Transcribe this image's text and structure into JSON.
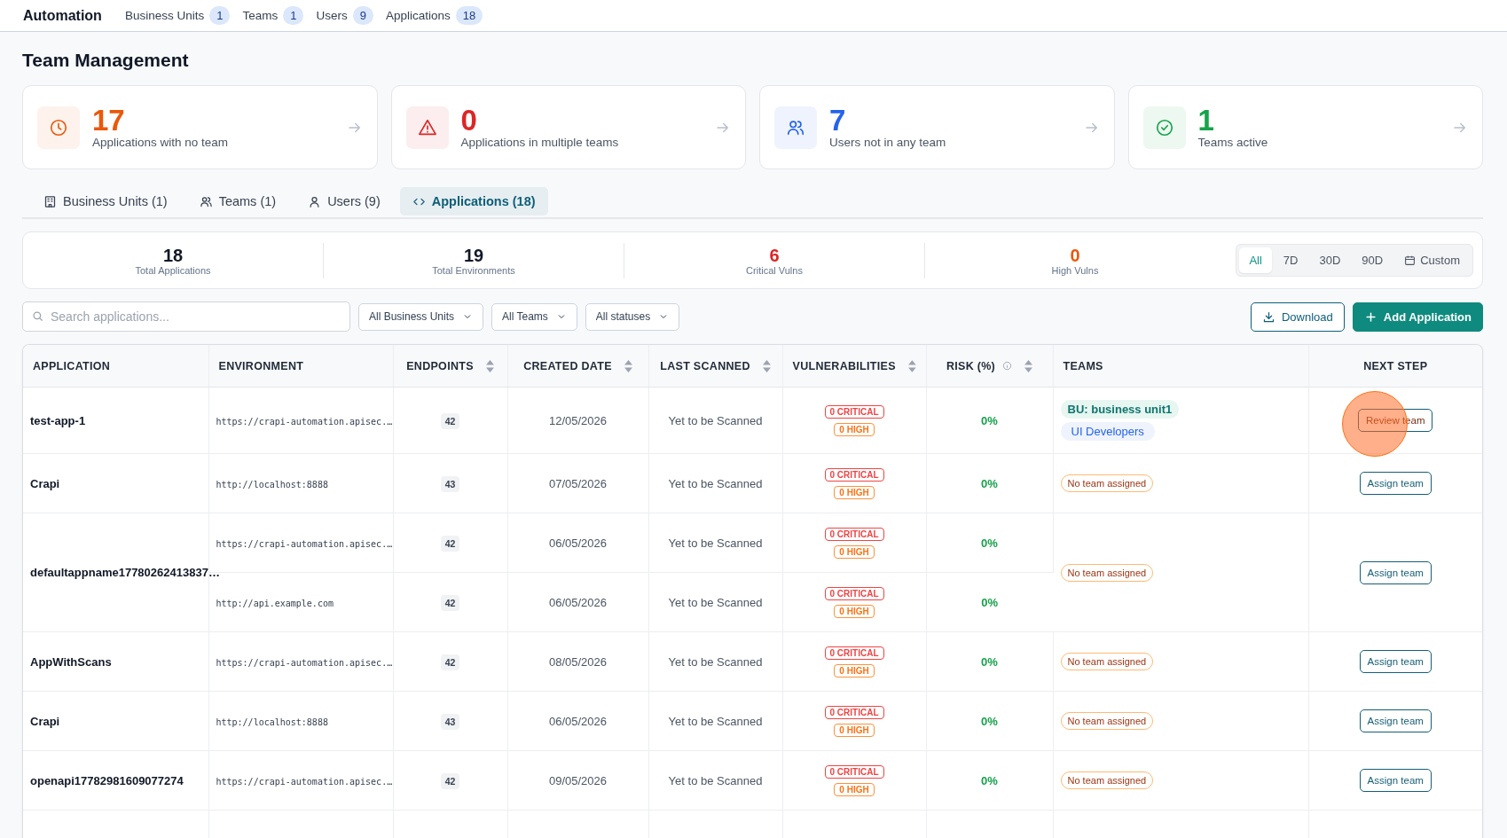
{
  "top_nav": {
    "brand": "Automation",
    "items": [
      {
        "label": "Business Units",
        "count": "1"
      },
      {
        "label": "Teams",
        "count": "1"
      },
      {
        "label": "Users",
        "count": "9"
      },
      {
        "label": "Applications",
        "count": "18"
      }
    ]
  },
  "page_title": "Team Management",
  "stat_cards": [
    {
      "kind": "clock",
      "value": "17",
      "label": "Applications with no team",
      "color": "#ea580c"
    },
    {
      "kind": "warning",
      "value": "0",
      "label": "Applications in multiple teams",
      "color": "#dc2626"
    },
    {
      "kind": "users",
      "value": "7",
      "label": "Users not in any team",
      "color": "#2563eb"
    },
    {
      "kind": "check",
      "value": "1",
      "label": "Teams active",
      "color": "#16a34a"
    }
  ],
  "tabs": [
    {
      "kind": "building",
      "label": "Business Units (1)",
      "selected": false
    },
    {
      "kind": "users",
      "label": "Teams (1)",
      "selected": false
    },
    {
      "kind": "user",
      "label": "Users (9)",
      "selected": false
    },
    {
      "kind": "code",
      "label": "Applications (18)",
      "selected": true
    }
  ],
  "summary": [
    {
      "value": "18",
      "label": "Total Applications",
      "color": "#111827"
    },
    {
      "value": "19",
      "label": "Total Environments",
      "color": "#111827"
    },
    {
      "value": "6",
      "label": "Critical Vulns",
      "color": "#dc2626"
    },
    {
      "value": "0",
      "label": "High Vulns",
      "color": "#ea580c"
    }
  ],
  "periods": [
    {
      "label": "All",
      "selected": true,
      "kind": "text"
    },
    {
      "label": "7D",
      "selected": false,
      "kind": "text"
    },
    {
      "label": "30D",
      "selected": false,
      "kind": "text"
    },
    {
      "label": "90D",
      "selected": false,
      "kind": "text"
    },
    {
      "label": "Custom",
      "selected": false,
      "kind": "calendar"
    }
  ],
  "search": {
    "placeholder": "Search applications..."
  },
  "filters": [
    "All Business Units",
    "All Teams",
    "All statuses"
  ],
  "actions": [
    {
      "kind": "download",
      "label": "Download"
    },
    {
      "kind": "add",
      "label": "Add Application"
    }
  ],
  "table": {
    "columns": [
      {
        "label": "APPLICATION",
        "kind": "plain"
      },
      {
        "label": "ENVIRONMENT",
        "kind": "plain"
      },
      {
        "label": "ENDPOINTS",
        "kind": "sortable"
      },
      {
        "label": "CREATED DATE",
        "kind": "sortable"
      },
      {
        "label": "LAST SCANNED",
        "kind": "sortable"
      },
      {
        "label": "VULNERABILITIES",
        "kind": "sortable"
      },
      {
        "label": "RISK (%)",
        "kind": "sortable_info"
      },
      {
        "label": "TEAMS",
        "kind": "plain"
      },
      {
        "label": "NEXT STEP",
        "kind": "plain"
      }
    ],
    "rows": [
      {
        "name": "test-app-1",
        "environments": [
          {
            "url": "https://crapi-automation.apisec.…",
            "endpoints": "42",
            "created": "12/05/2026",
            "last_scanned": "Yet to be Scanned",
            "critical": "0 CRITICAL",
            "high": "0 HIGH",
            "risk": "0%"
          }
        ],
        "teams": [
          {
            "kind": "bu",
            "label": "BU: business unit1"
          },
          {
            "kind": "team",
            "label": "UI Developers"
          }
        ],
        "next_step": "Review team",
        "clicked": true
      },
      {
        "name": "Crapi",
        "environments": [
          {
            "url": "http://localhost:8888",
            "endpoints": "43",
            "created": "07/05/2026",
            "last_scanned": "Yet to be Scanned",
            "critical": "0 CRITICAL",
            "high": "0 HIGH",
            "risk": "0%"
          }
        ],
        "teams": [
          {
            "kind": "none",
            "label": "No team assigned"
          }
        ],
        "next_step": "Assign team",
        "clicked": false
      },
      {
        "name": "defaultappname17780262413837…",
        "environments": [
          {
            "url": "https://crapi-automation.apisec.…",
            "endpoints": "42",
            "created": "06/05/2026",
            "last_scanned": "Yet to be Scanned",
            "critical": "0 CRITICAL",
            "high": "0 HIGH",
            "risk": "0%"
          },
          {
            "url": "http://api.example.com",
            "endpoints": "42",
            "created": "06/05/2026",
            "last_scanned": "Yet to be Scanned",
            "critical": "0 CRITICAL",
            "high": "0 HIGH",
            "risk": "0%"
          }
        ],
        "teams": [
          {
            "kind": "none",
            "label": "No team assigned"
          }
        ],
        "next_step": "Assign team",
        "clicked": false
      },
      {
        "name": "AppWithScans",
        "environments": [
          {
            "url": "https://crapi-automation.apisec.…",
            "endpoints": "42",
            "created": "08/05/2026",
            "last_scanned": "Yet to be Scanned",
            "critical": "0 CRITICAL",
            "high": "0 HIGH",
            "risk": "0%"
          }
        ],
        "teams": [
          {
            "kind": "none",
            "label": "No team assigned"
          }
        ],
        "next_step": "Assign team",
        "clicked": false
      },
      {
        "name": "Crapi",
        "environments": [
          {
            "url": "http://localhost:8888",
            "endpoints": "43",
            "created": "06/05/2026",
            "last_scanned": "Yet to be Scanned",
            "critical": "0 CRITICAL",
            "high": "0 HIGH",
            "risk": "0%"
          }
        ],
        "teams": [
          {
            "kind": "none",
            "label": "No team assigned"
          }
        ],
        "next_step": "Assign team",
        "clicked": false
      },
      {
        "name": "openapi17782981609077274",
        "environments": [
          {
            "url": "https://crapi-automation.apisec.…",
            "endpoints": "42",
            "created": "09/05/2026",
            "last_scanned": "Yet to be Scanned",
            "critical": "0 CRITICAL",
            "high": "0 HIGH",
            "risk": "0%"
          }
        ],
        "teams": [
          {
            "kind": "none",
            "label": "No team assigned"
          }
        ],
        "next_step": "Assign team",
        "clicked": false
      }
    ]
  }
}
